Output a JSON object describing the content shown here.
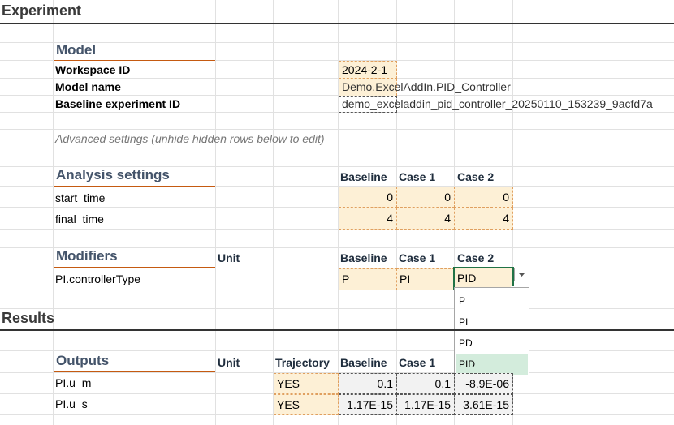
{
  "sections": {
    "experiment": "Experiment",
    "results": "Results"
  },
  "model": {
    "title": "Model",
    "workspace_label": "Workspace ID",
    "workspace_value": "2024-2-1",
    "model_name_label": "Model name",
    "model_name_value": "Demo.ExcelAddIn.PID_Controller",
    "baseline_label": "Baseline experiment ID",
    "baseline_value": "demo_exceladdin_pid_controller_20250110_153239_9acfd7a"
  },
  "advanced_note": "Advanced settings (unhide hidden rows below to edit)",
  "analysis": {
    "title": "Analysis settings",
    "columns": [
      "Baseline",
      "Case 1",
      "Case 2"
    ],
    "rows": [
      {
        "label": "start_time",
        "values": [
          "0",
          "0",
          "0"
        ]
      },
      {
        "label": "final_time",
        "values": [
          "4",
          "4",
          "4"
        ]
      }
    ]
  },
  "modifiers": {
    "title": "Modifiers",
    "unit_header": "Unit",
    "columns": [
      "Baseline",
      "Case 1",
      "Case 2"
    ],
    "rows": [
      {
        "label": "PI.controllerType",
        "values": [
          "P",
          "PI",
          "PID"
        ]
      }
    ]
  },
  "dropdown": {
    "options": [
      "P",
      "PI",
      "PD",
      "PID"
    ],
    "selected": "PID"
  },
  "outputs": {
    "title": "Outputs",
    "unit_header": "Unit",
    "trajectory_header": "Trajectory",
    "columns": [
      "Baseline",
      "Case 1",
      "Case 2"
    ],
    "rows": [
      {
        "label": "PI.u_m",
        "trajectory": "YES",
        "values": [
          "0.1",
          "0.1",
          "-8.9E-06"
        ]
      },
      {
        "label": "PI.u_s",
        "trajectory": "YES",
        "values": [
          "1.17E-15",
          "1.17E-15",
          "3.61E-15"
        ]
      }
    ]
  },
  "colors": {
    "accent_line": "#c55a11",
    "input_fill": "#fdf0d6",
    "selection_border": "#217346",
    "option_highlight": "#d3ecdc"
  }
}
